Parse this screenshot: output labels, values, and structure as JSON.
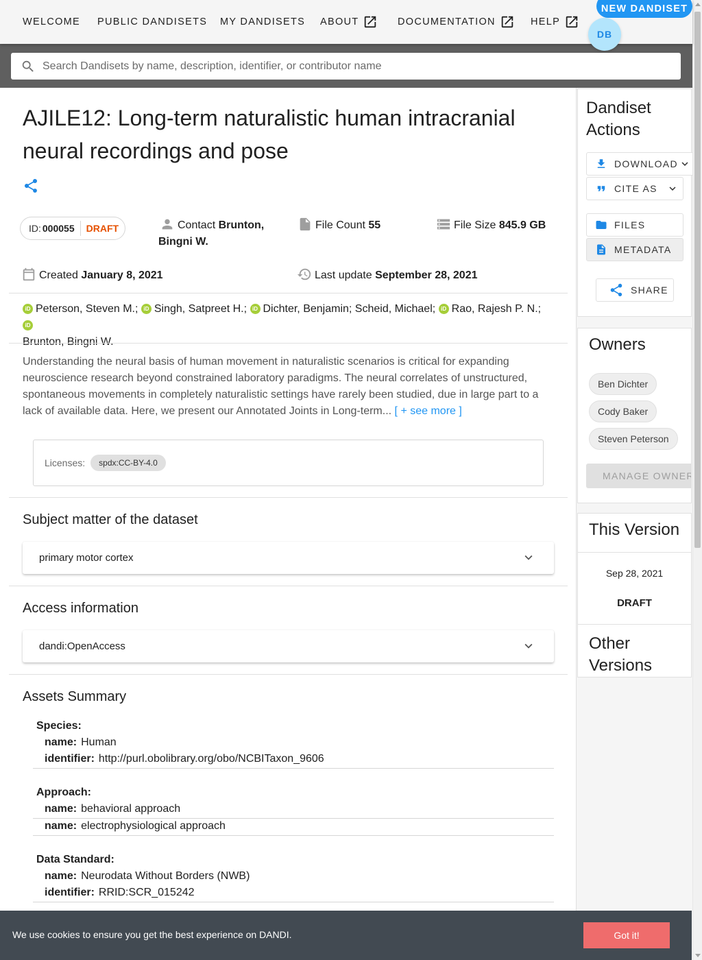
{
  "nav": {
    "items": [
      "WELCOME",
      "PUBLIC DANDISETS",
      "MY DANDISETS",
      "ABOUT",
      "DOCUMENTATION",
      "HELP"
    ],
    "new_button": "NEW DANDISET",
    "avatar": "DB"
  },
  "search": {
    "placeholder": "Search Dandisets by name, description, identifier, or contributor name"
  },
  "dandiset": {
    "title": "AJILE12: Long-term naturalistic human intracranial neural recordings and pose",
    "id_label": "ID:",
    "id": "000055",
    "status": "DRAFT",
    "contact_label": "Contact",
    "contact": "Brunton, Bingni W.",
    "file_count_label": "File Count",
    "file_count": "55",
    "file_size_label": "File Size",
    "file_size": "845.9 GB",
    "created_label": "Created",
    "created": "January 8, 2021",
    "updated_label": "Last update",
    "updated": "September 28, 2021",
    "contributors": [
      {
        "name": "Peterson, Steven M.;",
        "orcid": true
      },
      {
        "name": "Singh, Satpreet H.;",
        "orcid": true
      },
      {
        "name": "Dichter, Benjamin;",
        "orcid": true
      },
      {
        "name": "Scheid, Michael;",
        "orcid": false
      },
      {
        "name": "Rao, Rajesh P. N.;",
        "orcid": true
      },
      {
        "name": "Brunton, Bingni W.",
        "orcid": false
      }
    ],
    "description": "Understanding the neural basis of human movement in naturalistic scenarios is critical for expanding neuroscience research beyond constrained laboratory paradigms. The neural correlates of unstructured, spontaneous movements in completely naturalistic settings have rarely been studied, due in large part to a lack of available data. Here, we present our Annotated Joints in Long-term...",
    "see_more": "[ + see more ]",
    "licenses_label": "Licenses:",
    "license": "spdx:CC-BY-4.0",
    "subject_title": "Subject matter of the dataset",
    "subject": "primary motor cortex",
    "access_title": "Access information",
    "access": "dandi:OpenAccess",
    "assets_title": "Assets Summary",
    "assets": {
      "species_label": "Species:",
      "species_name": "Human",
      "species_identifier": "http://purl.obolibrary.org/obo/NCBITaxon_9606",
      "approach_label": "Approach:",
      "approach_1": "behavioral approach",
      "approach_2": "electrophysiological approach",
      "standard_label": "Data Standard:",
      "standard_name": "Neurodata Without Borders (NWB)",
      "standard_identifier": "RRID:SCR_015242",
      "name_key": "name:",
      "identifier_key": "identifier:"
    }
  },
  "sidebar": {
    "actions_title": "Dandiset Actions",
    "download": "DOWNLOAD",
    "cite": "CITE AS",
    "files": "FILES",
    "metadata": "METADATA",
    "share": "SHARE",
    "owners_title": "Owners",
    "owners": [
      "Ben Dichter",
      "Cody Baker",
      "Steven Peterson"
    ],
    "manage": "MANAGE OWNERS",
    "this_version_title": "This Version",
    "version_date": "Sep 28, 2021",
    "version_status": "DRAFT",
    "other_versions_title": "Other Versions"
  },
  "cookie": {
    "text": "We use cookies to ensure you get the best experience on DANDI.",
    "button": "Got it!"
  },
  "colors": {
    "accent": "#2196f3",
    "draft": "#e65100",
    "orcid": "#a6ce39",
    "cookie_bg": "#424a52",
    "cookie_btn": "#ef6c6c"
  }
}
